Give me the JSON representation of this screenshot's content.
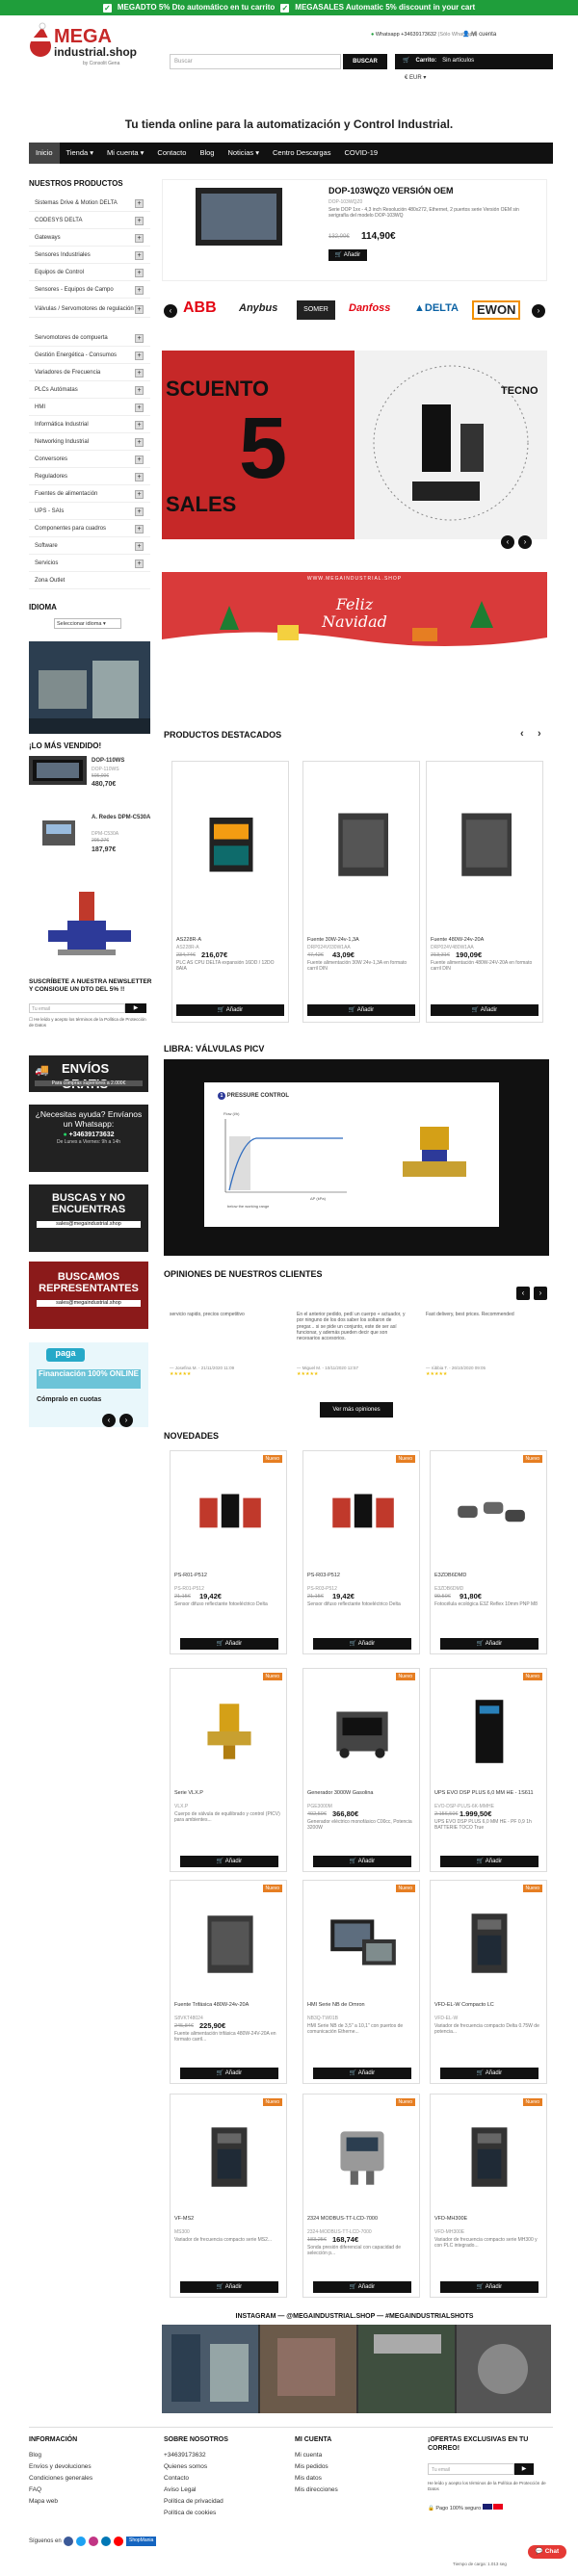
{
  "topbar": {
    "msg1": "MEGADTO 5% Dto automático en tu carrito",
    "msg2": "MEGASALES Automatic 5% discount in your cart"
  },
  "header": {
    "whatsapp": "Whatsapp +34639173632",
    "whatsapp_note": "(Sólo Whatsapp)",
    "account": "Mi cuenta",
    "logo_line1": "MEGA",
    "logo_line2": "industrial.shop",
    "logo_sub": "by Consolit Gena",
    "search_placeholder": "Buscar",
    "search_btn": "BUSCAR",
    "cart_label": "Carrito:",
    "cart_value": "Sin artículos",
    "currency": "€ EUR"
  },
  "tagline": "Tu tienda online para la automatización y Control Industrial.",
  "nav": [
    "Inicio",
    "Tienda",
    "Mi cuenta",
    "Contacto",
    "Blog",
    "Noticias",
    "Centro Descargas",
    "COVID-19"
  ],
  "sidebar": {
    "title": "NUESTROS PRODUCTOS",
    "items": [
      "Sistemas Drive & Motion DELTA",
      "CODESYS DELTA",
      "Gateways",
      "Sensores Industriales",
      "Equipos de Control",
      "Sensores - Equipos de Campo",
      "Válvulas / Servomotores de regulación",
      "Servomotores de compuerta",
      "Gestión Energética - Consumos",
      "Variadores de Frecuencia",
      "PLCs Autómatas",
      "HMI",
      "Informática Industrial",
      "Networking Industrial",
      "Conversores",
      "Reguladores",
      "Fuentes de alimentación",
      "UPS - SAIs",
      "Componentes para cuadros",
      "Software",
      "Servicios",
      "Zona Outlet"
    ],
    "lang_title": "IDIOMA",
    "lang_select": "Seleccionar idioma",
    "seen_title": "¡LO MÁS VENDIDO!",
    "seen": [
      {
        "name": "DOP-110WS",
        "ref": "DOP-110WS",
        "old": "505,00€",
        "price": "480,70€"
      },
      {
        "name": "A. Redes DPM-C530A",
        "ref": "DPM-C530A",
        "old": "205,27€",
        "price": "187,97€"
      }
    ],
    "newsletter_title": "SUSCRÍBETE A NUESTRA NEWSLETTER Y CONSIGUE UN DTO DEL 5% !!",
    "newsletter_ph": "Tu email",
    "newsletter_terms": "He leído y acepto los términos de la Política de Protección de Datos",
    "envios": "ENVÍOS GRATIS",
    "envios_sub": "Para compras superiores a 2.000€",
    "help_title": "¿Necesitas ayuda? Envíanos un Whatsapp:",
    "help_phone": "+34639173632",
    "help_hours": "De Lunes a Viernes: 9h a 14h",
    "buscas": "BUSCAS Y NO ENCUENTRAS",
    "buscas_mail": "sales@megaindustrial.shop",
    "reps": "BUSCAMOS REPRESENTANTES",
    "reps_mail": "sales@megaindustrial.shop",
    "paga_brand": "paga",
    "paga_title": "Financiación 100% ONLINE",
    "paga_sub": "Cómpralo en cuotas"
  },
  "featured": {
    "title": "DOP-103WQZ0 VERSIÓN OEM",
    "ref": "DOP-103WQZ0",
    "desc": "Serie DOP 1xx - 4,3 inch Resolución 480x272, Ethernet, 2 puertos serie Versión OEM sin serigrafía del modelo DOP-103WQ",
    "old": "132,00€",
    "price": "114,90€",
    "btn": "Añadir"
  },
  "brands": [
    "ABB",
    "Anybus",
    "SOMER",
    "Danfoss",
    "DELTA",
    "EWON"
  ],
  "banner1": {
    "text1": "SCUENTO",
    "text2": "5",
    "text3": "SALES",
    "brand": "TECNO"
  },
  "banner2": {
    "url": "WWW.MEGAINDUSTRIAL.SHOP",
    "line1": "Feliz",
    "line2": "Navidad"
  },
  "destacados": {
    "title": "PRODUCTOS DESTACADOS",
    "items": [
      {
        "name": "AS228R-A",
        "ref": "AS228R-A",
        "old": "234,74€",
        "price": "216,07€",
        "desc": "PLC AS CPU DELTA expansión 16DD / 12DO 8AIA",
        "btn": "Añadir"
      },
      {
        "name": "Fuente 30W-24v-1,3A",
        "ref": "DRP024V030W1AA",
        "old": "47,42€",
        "price": "43,09€",
        "desc": "Fuente alimentación 30W 24v-1,3A en formato carril DIN",
        "btn": "Añadir"
      },
      {
        "name": "Fuente 480W-24v-20A",
        "ref": "DRP024V480W1AA",
        "old": "213,31€",
        "price": "190,09€",
        "desc": "Fuente alimentación 480W-24V-20A en formato carril DIN",
        "btn": "Añadir"
      }
    ]
  },
  "libra": {
    "title": "LIBRA: VÁLVULAS PICV",
    "diagram_title": "PRESSURE CONTROL",
    "flow": "Flow (l/h)",
    "below": "below the working range",
    "dp": "ΔP (kPa)"
  },
  "opiniones": {
    "title": "OPINIONES DE NUESTROS CLIENTES",
    "items": [
      {
        "text": "servicio rapido, precios competitivo",
        "author": "— Josefina M. - 21/11/2020 11:09"
      },
      {
        "text": "En el anterior pedido, pedí un cuerpo + actuador, y por ninguno de los dos saber los soltaron de pregar... si se pide un conjunto, este de ser así funcionar, y además pueden decir que son necesarios accesorios.",
        "author": "— Miguel M. - 10/11/2020 12:57"
      },
      {
        "text": "Fast delivery, best prices. Recommended",
        "author": "— rúbbia T. - 26/10/2020 09:05"
      }
    ],
    "btn": "Ver más opiniones"
  },
  "novedades": {
    "title": "NOVEDADES",
    "badge": "Nuevo",
    "items": [
      {
        "name": "PS-R01-P512",
        "ref": "PS-R01-P512",
        "old": "21,15€",
        "price": "19,42€",
        "desc": "Sensor difuso reflectante fotoeléctrico Delta",
        "btn": "Añadir"
      },
      {
        "name": "PS-R03-P512",
        "ref": "PS-R03-P512",
        "old": "21,15€",
        "price": "19,42€",
        "desc": "Sensor difuso reflectante fotoeléctrico Delta",
        "btn": "Añadir"
      },
      {
        "name": "E3ZDB6DMD",
        "ref": "E3ZDB6DMD",
        "old": "99,50€",
        "price": "91,80€",
        "desc": "Fotocélula ecológica E3Z Reflex 10mm PNP M8",
        "btn": "Añadir"
      },
      {
        "name": "Serie VLX.P",
        "ref": "VLX.P",
        "old": "",
        "price": "",
        "desc": "Cuerpo de válvula de equilibrado y control (PICV) para ambientes...",
        "btn": "Añadir"
      },
      {
        "name": "Generador 3000W Gasolina",
        "ref": "PGE3000M",
        "old": "402,50€",
        "price": "366,80€",
        "desc": "Generador eléctrico monofásico C00cc, Potencia 3200W",
        "btn": "Añadir"
      },
      {
        "name": "UPS EVO DSP PLUS 6,0 MM HE - 1S611",
        "ref": "EVO-DSP-PLUS-6K-MMHE",
        "old": "2.156,50€",
        "price": "1.999,50€",
        "desc": "UPS EVO DSP PLUS 6,0 MM HE - PF 0,9 1h BATTERIE TOCO True",
        "btn": "Añadir"
      },
      {
        "name": "Fuente Trifásica 480W-24v-20A",
        "ref": "S8VKT48024",
        "old": "245,84€",
        "price": "225,90€",
        "desc": "Fuente alimentación trifásica 480W-24V-20A en formato carril...",
        "btn": "Añadir"
      },
      {
        "name": "HMI Serie NB de Omron",
        "ref": "NB3Q-TW01B",
        "old": "",
        "price": "",
        "desc": "HMI Serie NB de 3,5\" a 10,1\" con puertos de comunicación Etherne...",
        "btn": "Añadir"
      },
      {
        "name": "VFD-EL-W Compacto LC",
        "ref": "VFD-EL-W",
        "old": "",
        "price": "",
        "desc": "Variador de frecuencia compacto Delta 0.75W de potencia...",
        "btn": "Añadir"
      },
      {
        "name": "VF-MS2",
        "ref": "MS300",
        "old": "",
        "price": "",
        "desc": "Variador de frecuencia compacto serie MS2...",
        "btn": "Añadir"
      },
      {
        "name": "2324 MODBUS-TT-LCD-7000",
        "ref": "2324-MODBUS-TT-LCD-7000",
        "old": "183,25€",
        "price": "168,74€",
        "desc": "Sonda presión diferencial con capacidad de selección p...",
        "btn": "Añadir"
      },
      {
        "name": "VFD-MH300E",
        "ref": "VFD-MH300E",
        "old": "",
        "price": "",
        "desc": "Variador de frecuencia compacto serie MH300 y con PLC integrado...",
        "btn": "Añadir"
      }
    ]
  },
  "instagram": "INSTAGRAM — @MEGAINDUSTRIAL.SHOP — #MEGAINDUSTRIALSHOTS",
  "footer": {
    "col1": {
      "title": "INFORMACIÓN",
      "links": [
        "Blog",
        "Envíos y devoluciones",
        "Condiciones generales",
        "FAQ",
        "Mapa web"
      ]
    },
    "col2": {
      "title": "SOBRE NOSOTROS",
      "links": [
        "+34639173632",
        "Quienes somos",
        "Contacto",
        "Aviso Legal",
        "Política de privacidad",
        "Política de cookies"
      ]
    },
    "col3": {
      "title": "MI CUENTA",
      "links": [
        "Mi cuenta",
        "Mis pedidos",
        "Mis datos",
        "Mis direcciones"
      ]
    },
    "col4": {
      "title": "¡OFERTAS EXCLUSIVAS EN TU CORREO!",
      "ph": "Tu email",
      "terms": "He leído y acepto los términos de la Política de Protección de Datos",
      "secure": "Pago 100% seguro"
    },
    "follow": "Síguenos en",
    "shopmania": "ShopMania",
    "loadtime": "Tiempo de carga: 1.013 seg"
  },
  "chat": "Chat",
  "colors": {
    "green": "#1f9e3b",
    "black": "#111111",
    "red": "#c62828",
    "orange": "#e67e22"
  }
}
